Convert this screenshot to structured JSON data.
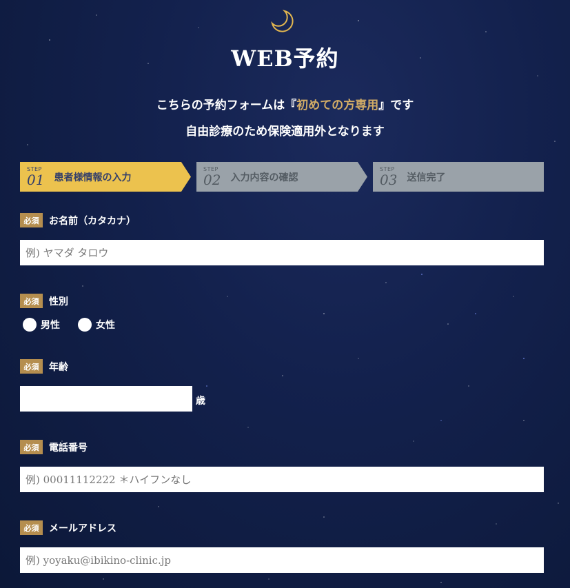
{
  "header": {
    "moon_icon": "crescent-moon-icon",
    "title": "WEB予約"
  },
  "intro": {
    "line1_before": "こちらの予約フォームは『",
    "line1_highlight": "初めての方専用",
    "line1_after": "』です",
    "line2": "自由診療のため保険適用外となります",
    "highlight_color": "#d2ac66"
  },
  "steps": [
    {
      "tag": "STEP",
      "number": "01",
      "label": "患者様情報の入力",
      "state": "active"
    },
    {
      "tag": "STEP",
      "number": "02",
      "label": "入力内容の確認",
      "state": "inactive"
    },
    {
      "tag": "STEP",
      "number": "03",
      "label": "送信完了",
      "state": "inactive"
    }
  ],
  "form": {
    "required_badge": "必須",
    "name": {
      "label": "お名前（カタカナ）",
      "value": "",
      "placeholder": "例) ヤマダ タロウ"
    },
    "gender": {
      "label": "性別",
      "options": [
        "男性",
        "女性"
      ]
    },
    "age": {
      "label": "年齢",
      "value": "",
      "unit": "歳"
    },
    "phone": {
      "label": "電話番号",
      "value": "",
      "placeholder": "例) 00011112222 ＊ハイフンなし"
    },
    "email": {
      "label": "メールアドレス",
      "value": "",
      "placeholder": "例) yoyaku@ibikino-clinic.jp"
    }
  },
  "colors": {
    "background": "#13214d",
    "step_active": "#ecc24e",
    "step_inactive": "#9aa2a9",
    "badge": "#b58e4f"
  }
}
